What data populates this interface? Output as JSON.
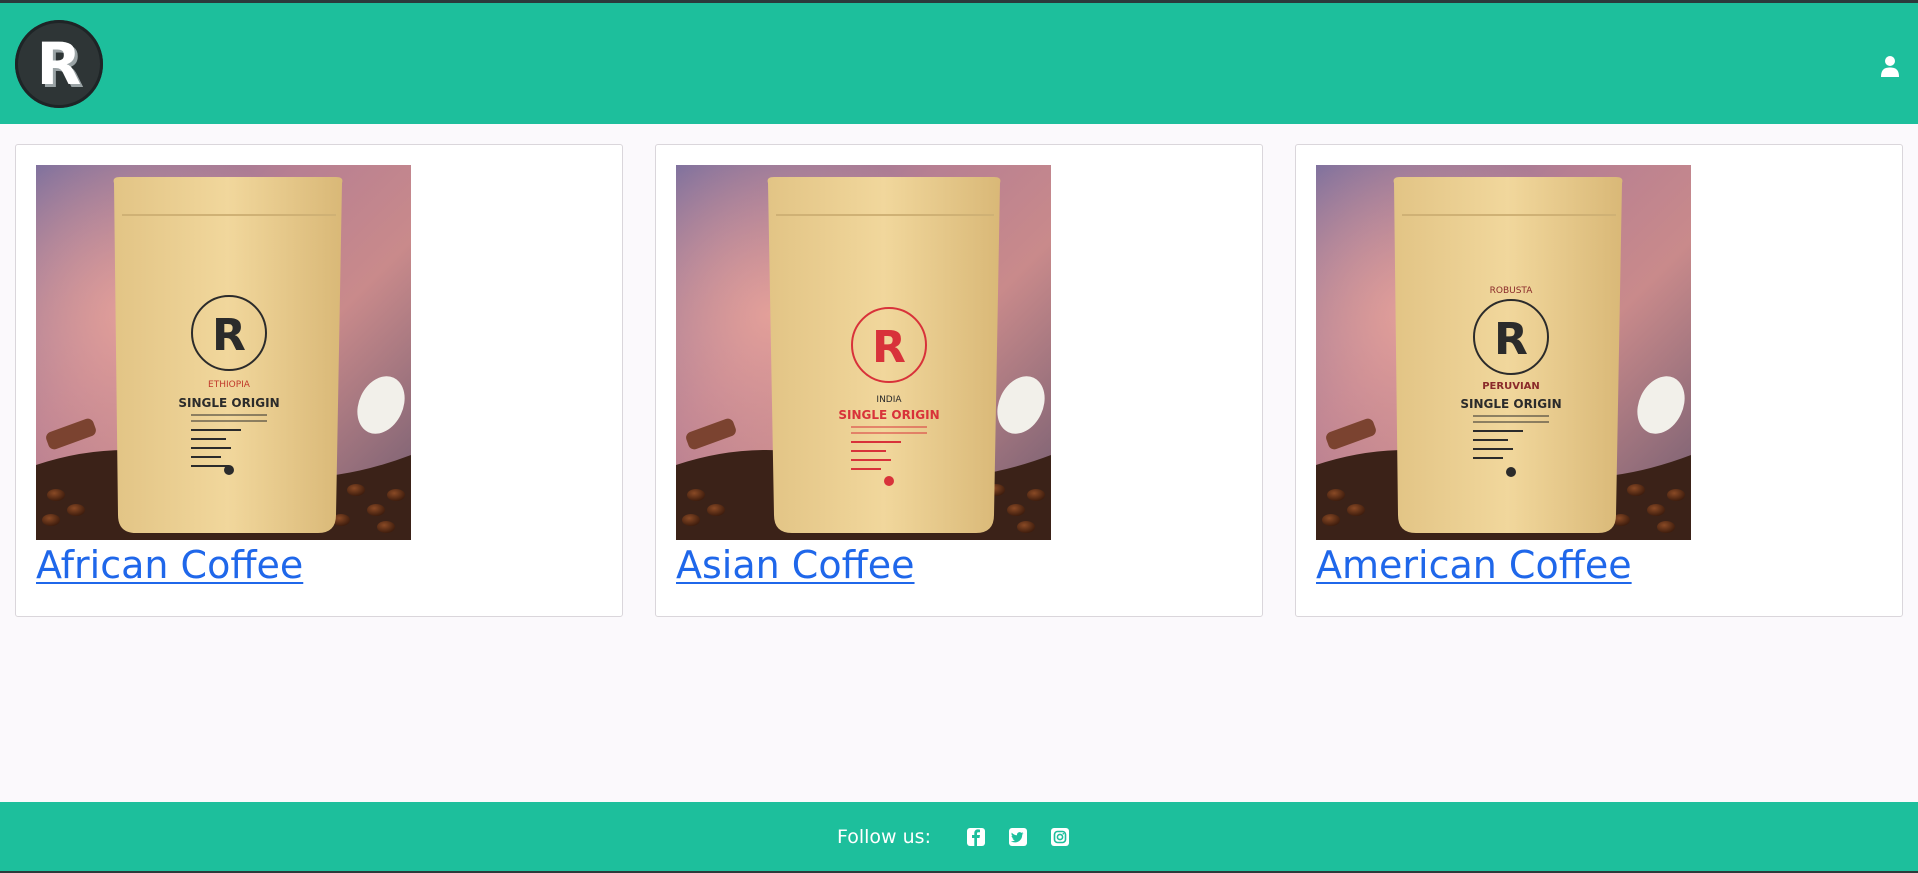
{
  "header": {
    "logo_letter": "R",
    "brand_color": "#1dbf9c",
    "user_icon": "user-icon"
  },
  "products": [
    {
      "title": "African Coffee",
      "bag_origin": "ETHIOPIA",
      "bag_label": "SINGLE ORIGIN",
      "bag_logo": "R",
      "bag_logo_color": "#2b2b2b",
      "bag_text_color": "#2b2b2b"
    },
    {
      "title": "Asian Coffee",
      "bag_origin": "INDIA",
      "bag_label": "SINGLE ORIGIN",
      "bag_logo": "R",
      "bag_logo_color": "#d8323a",
      "bag_text_color": "#d8323a"
    },
    {
      "title": "American Coffee",
      "bag_origin": "PERUVIAN",
      "bag_top": "ROBUSTA",
      "bag_label": "SINGLE ORIGIN",
      "bag_logo": "R",
      "bag_logo_color": "#2b2b2b",
      "bag_text_color": "#2b2b2b"
    }
  ],
  "footer": {
    "follow_label": "Follow us:",
    "social_icons": [
      "facebook-icon",
      "twitter-icon",
      "instagram-icon"
    ]
  },
  "colors": {
    "link": "#1f67ea",
    "page_bg": "#fbf9fc"
  }
}
